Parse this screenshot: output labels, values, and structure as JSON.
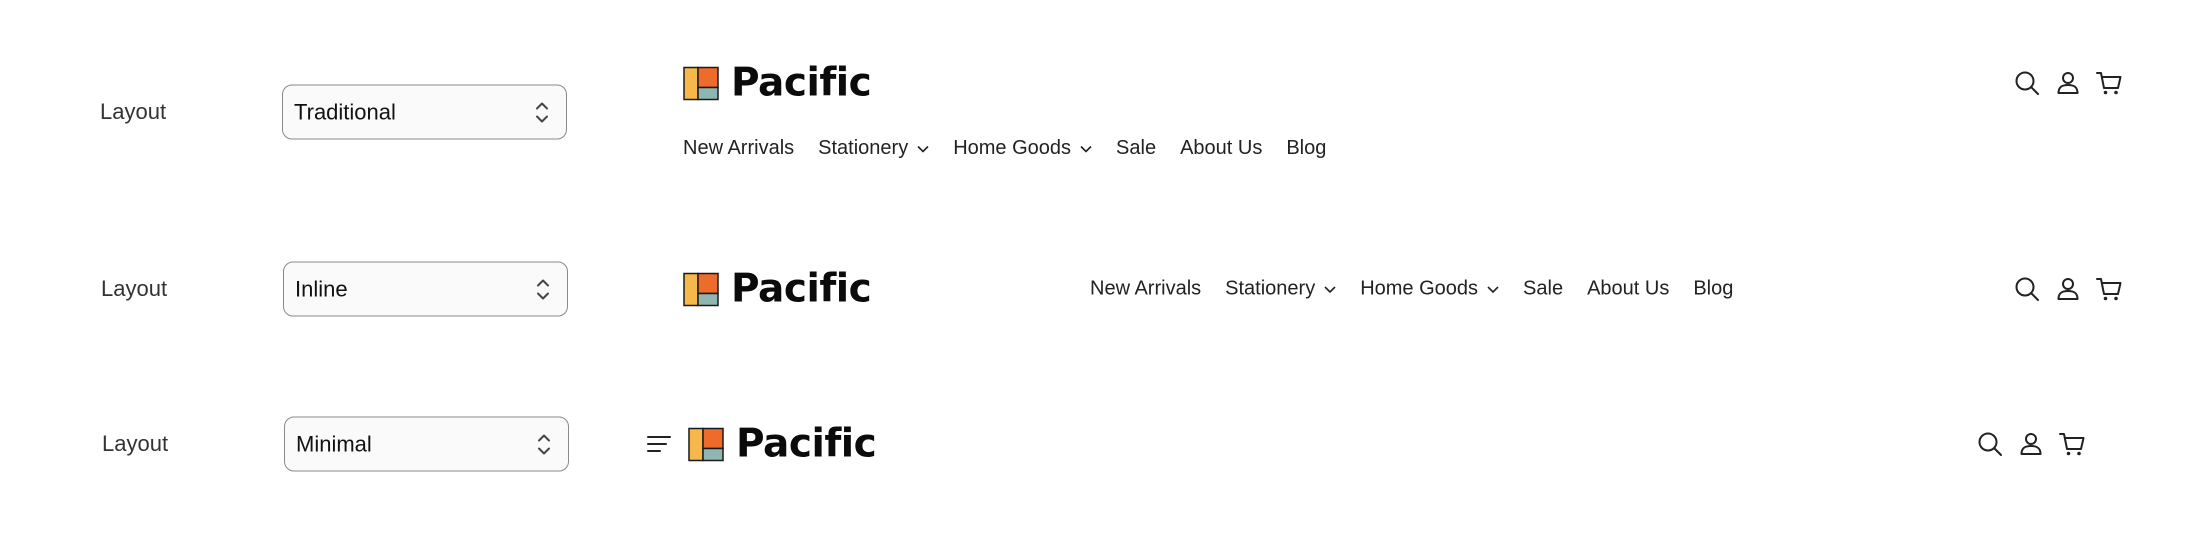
{
  "rows": [
    {
      "label": "Layout",
      "select_value": "Traditional",
      "brand": "Pacific",
      "nav": [
        "New Arrivals",
        "Stationery",
        "Home Goods",
        "Sale",
        "About Us",
        "Blog"
      ]
    },
    {
      "label": "Layout",
      "select_value": "Inline",
      "brand": "Pacific",
      "nav": [
        "New Arrivals",
        "Stationery",
        "Home Goods",
        "Sale",
        "About Us",
        "Blog"
      ]
    },
    {
      "label": "Layout",
      "select_value": "Minimal",
      "brand": "Pacific"
    }
  ],
  "icons": {
    "search": "search-icon",
    "account": "user-icon",
    "cart": "cart-icon",
    "menu": "hamburger-menu-icon",
    "select": "chevron-up-down-icon",
    "dropdown": "chevron-down-icon"
  },
  "colors": {
    "logo_yellow": "#f6b84b",
    "logo_orange": "#ee6b2c",
    "logo_teal": "#8fb6b3",
    "text": "#1a1a1a",
    "select_border": "#8a8a8a"
  }
}
